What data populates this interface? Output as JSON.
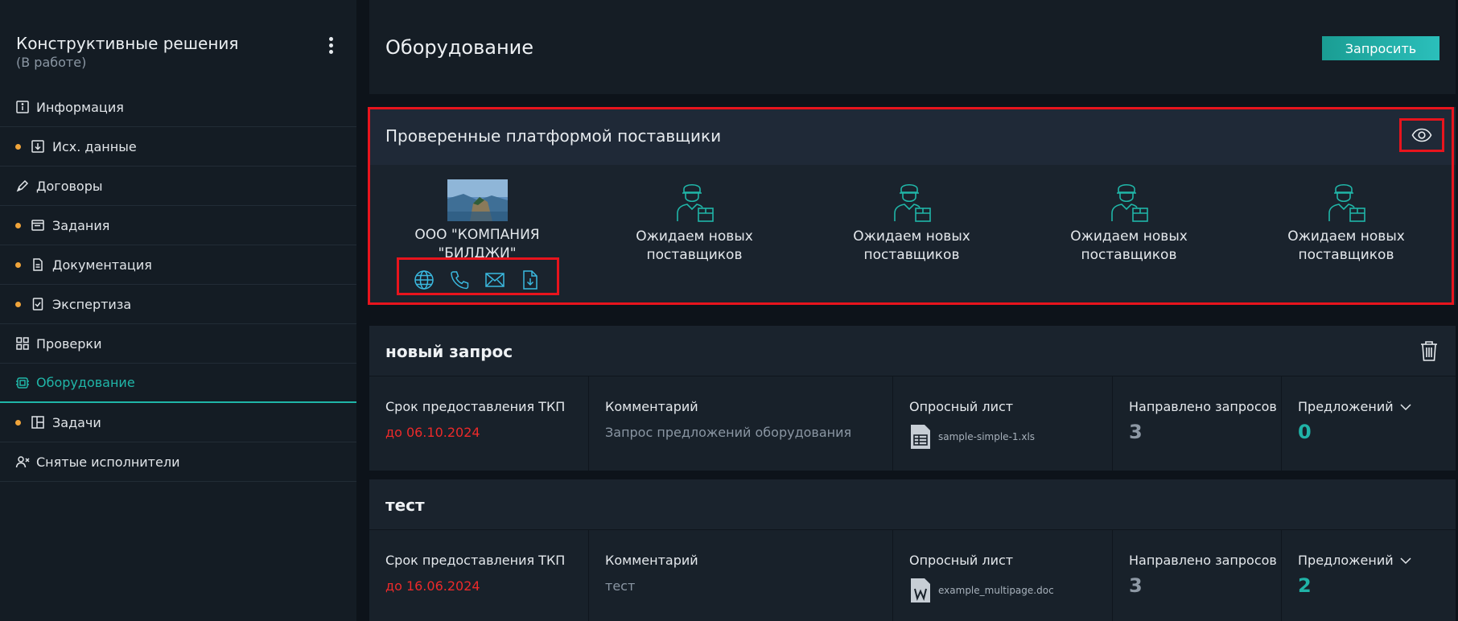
{
  "sidebar": {
    "project_title": "Конструктивные решения",
    "project_status": "(В работе)",
    "items": [
      {
        "label": "Информация",
        "icon": "info-icon",
        "dot": false,
        "active": false
      },
      {
        "label": "Исх. данные",
        "icon": "download-box-icon",
        "dot": true,
        "active": false
      },
      {
        "label": "Договоры",
        "icon": "pen-icon",
        "dot": false,
        "active": false
      },
      {
        "label": "Задания",
        "icon": "window-icon",
        "dot": true,
        "active": false
      },
      {
        "label": "Документация",
        "icon": "document-icon",
        "dot": true,
        "active": false
      },
      {
        "label": "Экспертиза",
        "icon": "check-doc-icon",
        "dot": true,
        "active": false
      },
      {
        "label": "Проверки",
        "icon": "grid-icon",
        "dot": false,
        "active": false
      },
      {
        "label": "Оборудование",
        "icon": "chip-icon",
        "dot": false,
        "active": true
      },
      {
        "label": "Задачи",
        "icon": "board-icon",
        "dot": true,
        "active": false
      },
      {
        "label": "Снятые исполнители",
        "icon": "user-remove-icon",
        "dot": false,
        "active": false
      }
    ]
  },
  "header": {
    "title": "Оборудование",
    "request_button": "Запросить"
  },
  "suppliers": {
    "title": "Проверенные платформой поставщики",
    "cards": [
      {
        "name": "ООО \"КОМПАНИЯ \"БИЛДЖИ\"",
        "has_logo": true
      },
      {
        "name": "Ожидаем новых поставщиков",
        "has_logo": false
      },
      {
        "name": "Ожидаем новых поставщиков",
        "has_logo": false
      },
      {
        "name": "Ожидаем новых поставщиков",
        "has_logo": false
      },
      {
        "name": "Ожидаем новых поставщиков",
        "has_logo": false
      }
    ],
    "contact_icons": [
      "globe-icon",
      "phone-icon",
      "mail-icon",
      "file-download-icon"
    ]
  },
  "requests": [
    {
      "name": "новый запрос",
      "deadline_label": "Срок предоставления ТКП",
      "deadline_value": "до 06.10.2024",
      "comment_label": "Комментарий",
      "comment_value": "Запрос предложений оборудования",
      "sheet_label": "Опросный лист",
      "sheet_file": "sample-simple-1.xls",
      "sheet_type": "xls",
      "sent_label": "Направлено запросов",
      "sent_value": "3",
      "offers_label": "Предложений",
      "offers_value": "0"
    },
    {
      "name": "тест",
      "deadline_label": "Срок предоставления ТКП",
      "deadline_value": "до 16.06.2024",
      "comment_label": "Комментарий",
      "comment_value": "тест",
      "sheet_label": "Опросный лист",
      "sheet_file": "example_multipage.doc",
      "sheet_type": "doc",
      "sent_label": "Направлено запросов",
      "sent_value": "3",
      "offers_label": "Предложений",
      "offers_value": "2"
    }
  ],
  "colors": {
    "accent": "#20b6a8",
    "dot": "#f0a43a",
    "deadline": "#ec2a2a",
    "highlight_box": "#e8141d"
  }
}
